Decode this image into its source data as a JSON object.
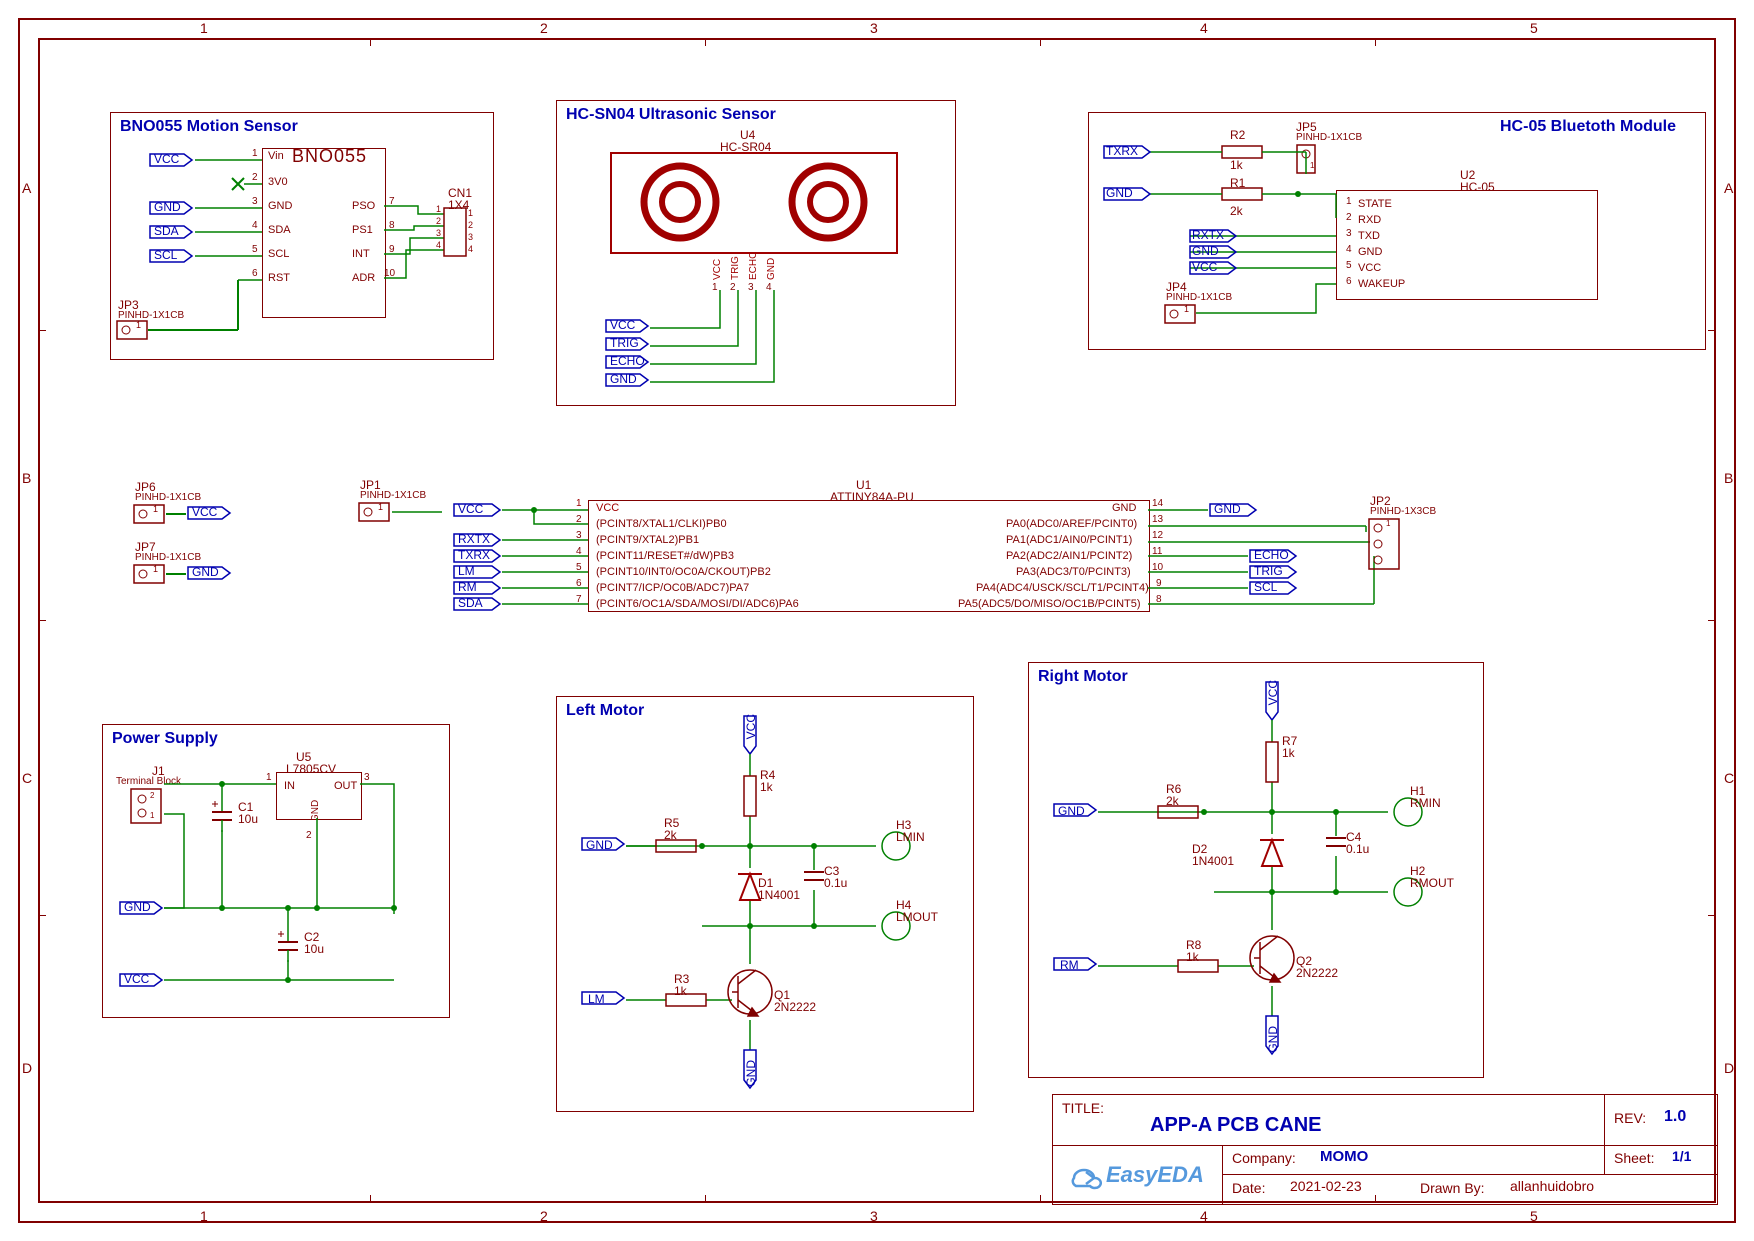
{
  "grid": {
    "cols": [
      "1",
      "2",
      "3",
      "4",
      "5"
    ],
    "rows": [
      "A",
      "B",
      "C",
      "D"
    ]
  },
  "blocks": {
    "bno": {
      "title": "BNO055 Motion Sensor",
      "part": "BNO055",
      "ref": "",
      "cn": {
        "ref": "CN1",
        "val": "1X4",
        "pins": [
          "1",
          "2",
          "3",
          "4"
        ]
      },
      "left_nets": [
        "VCC",
        "",
        "GND",
        "SDA",
        "SCL"
      ],
      "left_pins": [
        {
          "n": "1",
          "name": "Vin"
        },
        {
          "n": "2",
          "name": "3V0"
        },
        {
          "n": "3",
          "name": "GND"
        },
        {
          "n": "4",
          "name": "SDA"
        },
        {
          "n": "5",
          "name": "SCL"
        },
        {
          "n": "6",
          "name": "RST"
        }
      ],
      "right_pins": [
        {
          "n": "7",
          "name": "PSO"
        },
        {
          "n": "8",
          "name": "PS1"
        },
        {
          "n": "9",
          "name": "INT"
        },
        {
          "n": "10",
          "name": "ADR"
        }
      ],
      "jp": {
        "ref": "JP3",
        "val": "PINHD-1X1CB"
      }
    },
    "hc04": {
      "title": "HC-SN04 Ultrasonic Sensor",
      "ref": "U4",
      "part": "HC-SR04",
      "bottom_pins": [
        "VCC",
        "TRIG",
        "ECHO",
        "GND"
      ],
      "bottom_nums": [
        "1",
        "2",
        "3",
        "4"
      ],
      "nets": [
        "VCC",
        "TRIG",
        "ECHO",
        "GND"
      ]
    },
    "hc05": {
      "title": "HC-05 Bluetoth Module",
      "ref": "U2",
      "part": "HC-05",
      "r1": {
        "ref": "R1",
        "val": "2k"
      },
      "r2": {
        "ref": "R2",
        "val": "1k"
      },
      "jp5": {
        "ref": "JP5",
        "val": "PINHD-1X1CB"
      },
      "jp4": {
        "ref": "JP4",
        "val": "PINHD-1X1CB"
      },
      "left_nets": [
        "TXRX",
        "GND",
        "RXTX",
        "GND",
        "VCC"
      ],
      "right_pins": [
        {
          "n": "1",
          "name": "STATE"
        },
        {
          "n": "2",
          "name": "RXD"
        },
        {
          "n": "3",
          "name": "TXD"
        },
        {
          "n": "4",
          "name": "GND"
        },
        {
          "n": "5",
          "name": "VCC"
        },
        {
          "n": "6",
          "name": "WAKEUP"
        }
      ]
    },
    "mcu": {
      "ref": "U1",
      "part": "ATTINY84A-PU",
      "jp1": {
        "ref": "JP1",
        "val": "PINHD-1X1CB"
      },
      "jp2": {
        "ref": "JP2",
        "val": "PINHD-1X3CB"
      },
      "jp6": {
        "ref": "JP6",
        "val": "PINHD-1X1CB"
      },
      "jp7": {
        "ref": "JP7",
        "val": "PINHD-1X1CB"
      },
      "jp6_net": "VCC",
      "jp7_net": "GND",
      "left_nets": [
        "VCC",
        "RXTX",
        "TXRX",
        "LM",
        "RM",
        "SDA"
      ],
      "left_pins": [
        {
          "n": "1",
          "name": "VCC",
          "red": true
        },
        {
          "n": "2",
          "name": "(PCINT8/XTAL1/CLKI)PB0"
        },
        {
          "n": "3",
          "name": "(PCINT9/XTAL2)PB1"
        },
        {
          "n": "4",
          "name": "(PCINT11/RESET#/dW)PB3"
        },
        {
          "n": "5",
          "name": "(PCINT10/INT0/OC0A/CKOUT)PB2"
        },
        {
          "n": "6",
          "name": "(PCINT7/ICP/OC0B/ADC7)PA7"
        },
        {
          "n": "7",
          "name": "(PCINT6/OC1A/SDA/MOSI/DI/ADC6)PA6"
        }
      ],
      "right_pins": [
        {
          "n": "14",
          "name": "GND"
        },
        {
          "n": "13",
          "name": "PA0(ADC0/AREF/PCINT0)"
        },
        {
          "n": "12",
          "name": "PA1(ADC1/AIN0/PCINT1)"
        },
        {
          "n": "11",
          "name": "PA2(ADC2/AIN1/PCINT2)"
        },
        {
          "n": "10",
          "name": "PA3(ADC3/T0/PCINT3)"
        },
        {
          "n": "9",
          "name": "PA4(ADC4/USCK/SCL/T1/PCINT4)"
        },
        {
          "n": "8",
          "name": "PA5(ADC5/DO/MISO/OC1B/PCINT5)"
        }
      ],
      "right_nets": [
        "GND",
        "",
        "",
        "ECHO",
        "TRIG",
        "SCL",
        ""
      ]
    },
    "power": {
      "title": "Power Supply",
      "j1": {
        "ref": "J1",
        "val": "Terminal Block"
      },
      "u5": {
        "ref": "U5",
        "part": "L7805CV",
        "pins": {
          "in": "IN",
          "out": "OUT",
          "gnd": "GND",
          "n1": "1",
          "n2": "2",
          "n3": "3"
        }
      },
      "c1": {
        "ref": "C1",
        "val": "10u"
      },
      "c2": {
        "ref": "C2",
        "val": "10u"
      },
      "nets": {
        "gnd": "GND",
        "vcc": "VCC"
      }
    },
    "leftmotor": {
      "title": "Left Motor",
      "vcc": "VCC",
      "gnd": "GND",
      "lm": "LM",
      "r5": {
        "ref": "R5",
        "val": "2k"
      },
      "r4": {
        "ref": "R4",
        "val": "1k"
      },
      "r3": {
        "ref": "R3",
        "val": "1k"
      },
      "d1": {
        "ref": "D1",
        "val": "1N4001"
      },
      "c3": {
        "ref": "C3",
        "val": "0.1u"
      },
      "q1": {
        "ref": "Q1",
        "val": "2N2222"
      },
      "h3": {
        "ref": "H3",
        "val": "LMIN"
      },
      "h4": {
        "ref": "H4",
        "val": "LMOUT"
      },
      "gnd2": "GND"
    },
    "rightmotor": {
      "title": "Right Motor",
      "vcc": "VCC",
      "gnd": "GND",
      "rm": "RM",
      "r6": {
        "ref": "R6",
        "val": "2k"
      },
      "r7": {
        "ref": "R7",
        "val": "1k"
      },
      "r8": {
        "ref": "R8",
        "val": "1k"
      },
      "d2": {
        "ref": "D2",
        "val": "1N4001"
      },
      "c4": {
        "ref": "C4",
        "val": "0.1u"
      },
      "q2": {
        "ref": "Q2",
        "val": "2N2222"
      },
      "h1": {
        "ref": "H1",
        "val": "RMIN"
      },
      "h2": {
        "ref": "H2",
        "val": "RMOUT"
      },
      "gnd2": "GND"
    }
  },
  "titleblock": {
    "title_label": "TITLE:",
    "title": "APP-A PCB CANE",
    "rev_label": "REV:",
    "rev": "1.0",
    "company_label": "Company:",
    "company": "MOMO",
    "sheet_label": "Sheet:",
    "sheet": "1/1",
    "date_label": "Date:",
    "date": "2021-02-23",
    "drawn_label": "Drawn By:",
    "drawn": "allanhuidobro",
    "logo": "EasyEDA"
  }
}
